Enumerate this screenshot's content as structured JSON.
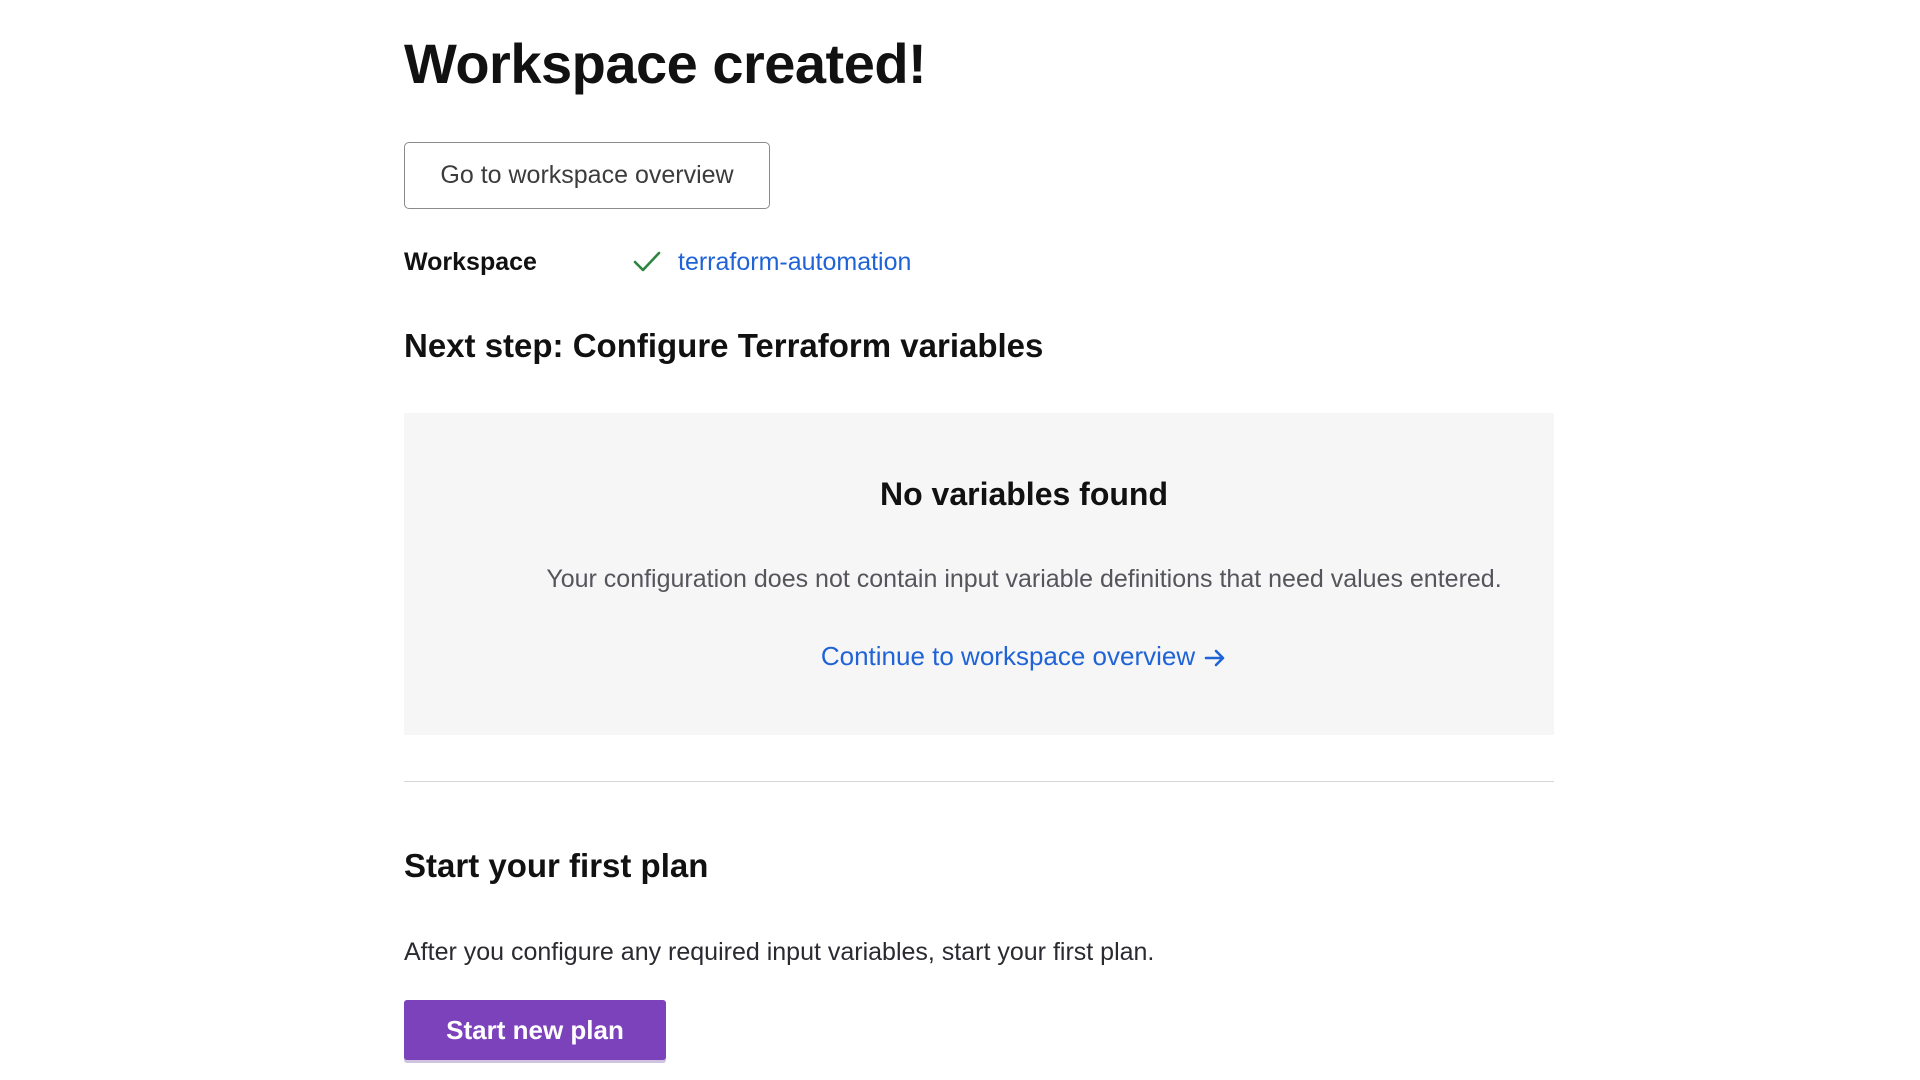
{
  "page": {
    "title": "Workspace created!"
  },
  "overview_button": {
    "label": "Go to workspace overview"
  },
  "workspace": {
    "label": "Workspace",
    "status_icon": "check-icon",
    "name": "terraform-automation"
  },
  "next_step": {
    "heading": "Next step: Configure Terraform variables"
  },
  "variables_panel": {
    "title": "No variables found",
    "description": "Your configuration does not contain input variable definitions that need values entered.",
    "continue_link": "Continue to workspace overview",
    "continue_icon": "arrow-right-icon"
  },
  "first_plan": {
    "heading": "Start your first plan",
    "description": "After you configure any required input variables, start your first plan.",
    "button_label": "Start new plan"
  },
  "colors": {
    "primary": "#7b42bc",
    "link": "#1f63d6",
    "success": "#2e8540",
    "panel_bg": "#f6f6f7"
  }
}
